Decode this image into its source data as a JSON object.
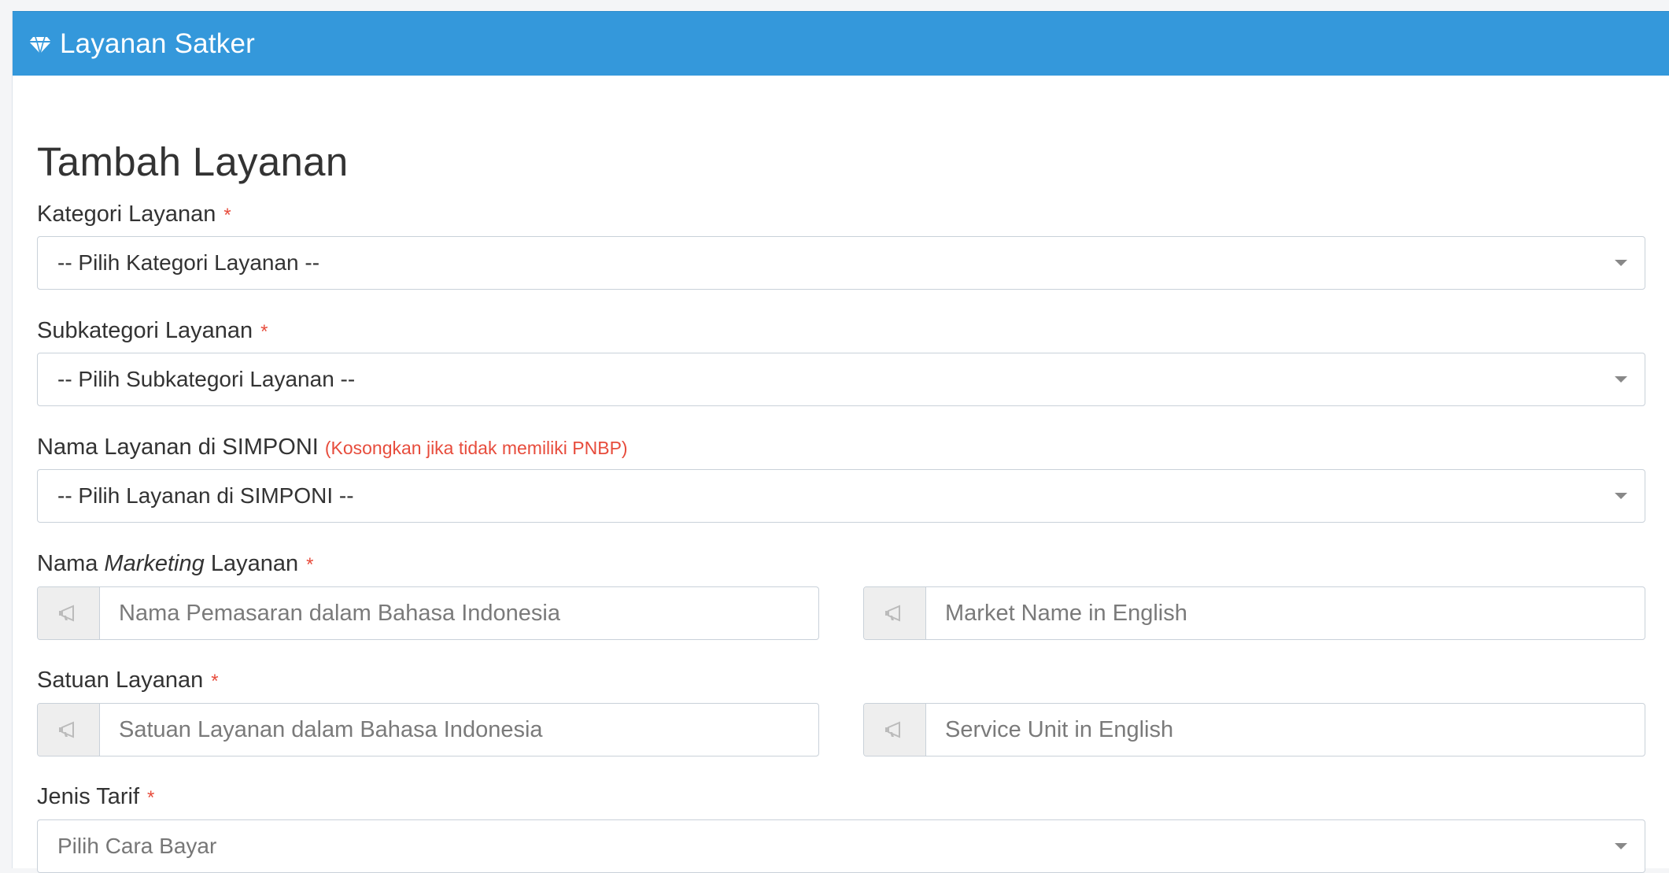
{
  "header": {
    "icon": "diamond-icon",
    "title": "Layanan Satker"
  },
  "page_title": "Tambah Layanan",
  "fields": {
    "kategori": {
      "label": "Kategori Layanan",
      "required_mark": "*",
      "selected": "-- Pilih Kategori Layanan --"
    },
    "subkategori": {
      "label": "Subkategori Layanan",
      "required_mark": "*",
      "selected": "-- Pilih Subkategori Layanan --"
    },
    "simponi": {
      "label": "Nama Layanan di SIMPONI",
      "note": "(Kosongkan jika tidak memiliki PNBP)",
      "selected": "-- Pilih Layanan di SIMPONI --"
    },
    "marketing": {
      "label_prefix": "Nama",
      "label_italic": "Marketing",
      "label_suffix": "Layanan",
      "required_mark": "*",
      "input_id_placeholder": "Nama Pemasaran dalam Bahasa Indonesia",
      "input_en_placeholder": "Market Name in English",
      "addon_icon": "bullhorn-icon"
    },
    "satuan": {
      "label": "Satuan Layanan",
      "required_mark": "*",
      "input_id_placeholder": "Satuan Layanan dalam Bahasa Indonesia",
      "input_en_placeholder": "Service Unit in English",
      "addon_icon": "bullhorn-icon"
    },
    "tarif": {
      "label": "Jenis Tarif",
      "required_mark": "*",
      "selected": "Pilih Cara Bayar"
    }
  },
  "colors": {
    "header_bg": "#3498db",
    "required": "#e74c3c"
  }
}
